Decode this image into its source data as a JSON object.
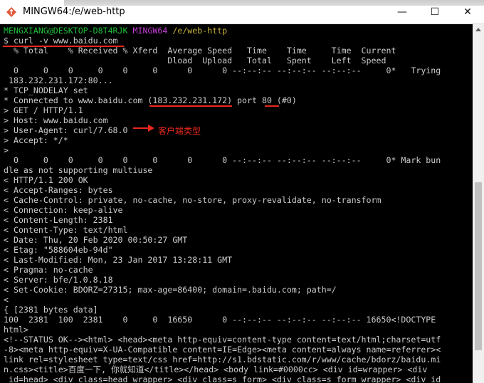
{
  "window": {
    "title": "MINGW64:/e/web-http",
    "minimize_glyph": "—",
    "maximize_glyph": "☐",
    "close_glyph": "✕",
    "icon": "git-bash-icon"
  },
  "prompt": {
    "user_host": "MENGXIANG@DESKTOP-D8T4RJK",
    "shell": "MINGW64",
    "path": "/e/web-http",
    "command": "$ curl -v www.baidu.com"
  },
  "output_lines": [
    "  % Total    % Received % Xferd  Average Speed   Time    Time     Time  Current",
    "                                 Dload  Upload   Total   Spent    Left  Speed",
    "  0     0    0     0    0     0      0      0 --:--:-- --:--:-- --:--:--     0*   Trying",
    " 183.232.231.172:80...",
    "* TCP_NODELAY set",
    "* Connected to www.baidu.com (183.232.231.172) port 80 (#0)",
    "> GET / HTTP/1.1",
    "> Host: www.baidu.com",
    "> User-Agent: curl/7.68.0",
    "> Accept: */*",
    ">",
    "  0     0    0     0    0     0      0      0 --:--:-- --:--:-- --:--:--     0* Mark bun",
    "dle as not supporting multiuse",
    "< HTTP/1.1 200 OK",
    "< Accept-Ranges: bytes",
    "< Cache-Control: private, no-cache, no-store, proxy-revalidate, no-transform",
    "< Connection: keep-alive",
    "< Content-Length: 2381",
    "< Content-Type: text/html",
    "< Date: Thu, 20 Feb 2020 00:50:27 GMT",
    "< Etag: \"588604eb-94d\"",
    "< Last-Modified: Mon, 23 Jan 2017 13:28:11 GMT",
    "< Pragma: no-cache",
    "< Server: bfe/1.0.8.18",
    "< Set-Cookie: BDORZ=27315; max-age=86400; domain=.baidu.com; path=/",
    "<",
    "{ [2381 bytes data]",
    "100  2381  100  2381    0     0  16650      0 --:--:-- --:--:-- --:--:-- 16650<!DOCTYPE",
    "html>",
    "<!--STATUS OK--><html> <head><meta http-equiv=content-type content=text/html;charset=utf",
    "-8><meta http-equiv=X-UA-Compatible content=IE=Edge><meta content=always name=referrer><",
    "link rel=stylesheet type=text/css href=http://s1.bdstatic.com/r/www/cache/bdorz/baidu.mi",
    "n.css><title>百度一下, 你就知道</title></head> <body link=#0000cc> <div id=wrapper> <div",
    " id=head> <div class=head_wrapper> <div class=s_form> <div class=s_form_wrapper> <div id"
  ],
  "annotation": {
    "label": "客户端类型"
  },
  "colors": {
    "prompt_user": "#1fbf3a",
    "prompt_shell": "#c53fd6",
    "prompt_path": "#c8b43d",
    "annotation": "#e8281e",
    "text": "#cccccc"
  }
}
